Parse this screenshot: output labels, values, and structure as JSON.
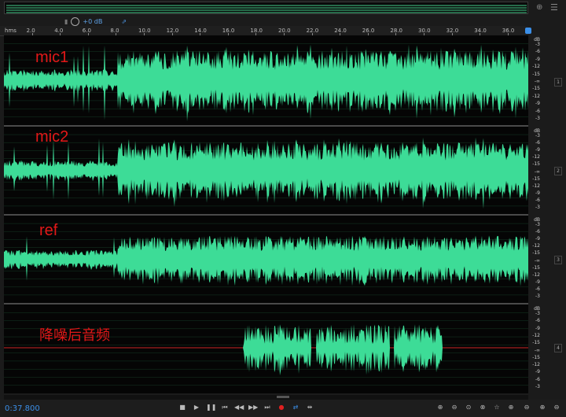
{
  "hud": {
    "gain_value": "+0 dB"
  },
  "ruler": {
    "unit": "hms",
    "ticks": [
      "2.0",
      "4.0",
      "6.0",
      "8.0",
      "10.0",
      "12.0",
      "14.0",
      "16.0",
      "18.0",
      "20.0",
      "22.0",
      "24.0",
      "26.0",
      "28.0",
      "30.0",
      "32.0",
      "34.0",
      "36.0"
    ]
  },
  "tracks": [
    {
      "label": "mic1",
      "channel": "1"
    },
    {
      "label": "mic2",
      "channel": "2"
    },
    {
      "label": "ref",
      "channel": "3"
    },
    {
      "label": "降噪后音频",
      "channel": "4"
    }
  ],
  "db_scale": {
    "header": "dB",
    "labels": [
      "-3",
      "-6",
      "-9",
      "-12",
      "-15",
      "-∞",
      "-15",
      "-12",
      "-9",
      "-6",
      "-3"
    ]
  },
  "transport": {
    "current_time": "0:37.800"
  },
  "colors": {
    "waveform": "#3ddc97",
    "label": "#e31818",
    "playhead": "#cc2222",
    "time": "#3b8fe8"
  }
}
